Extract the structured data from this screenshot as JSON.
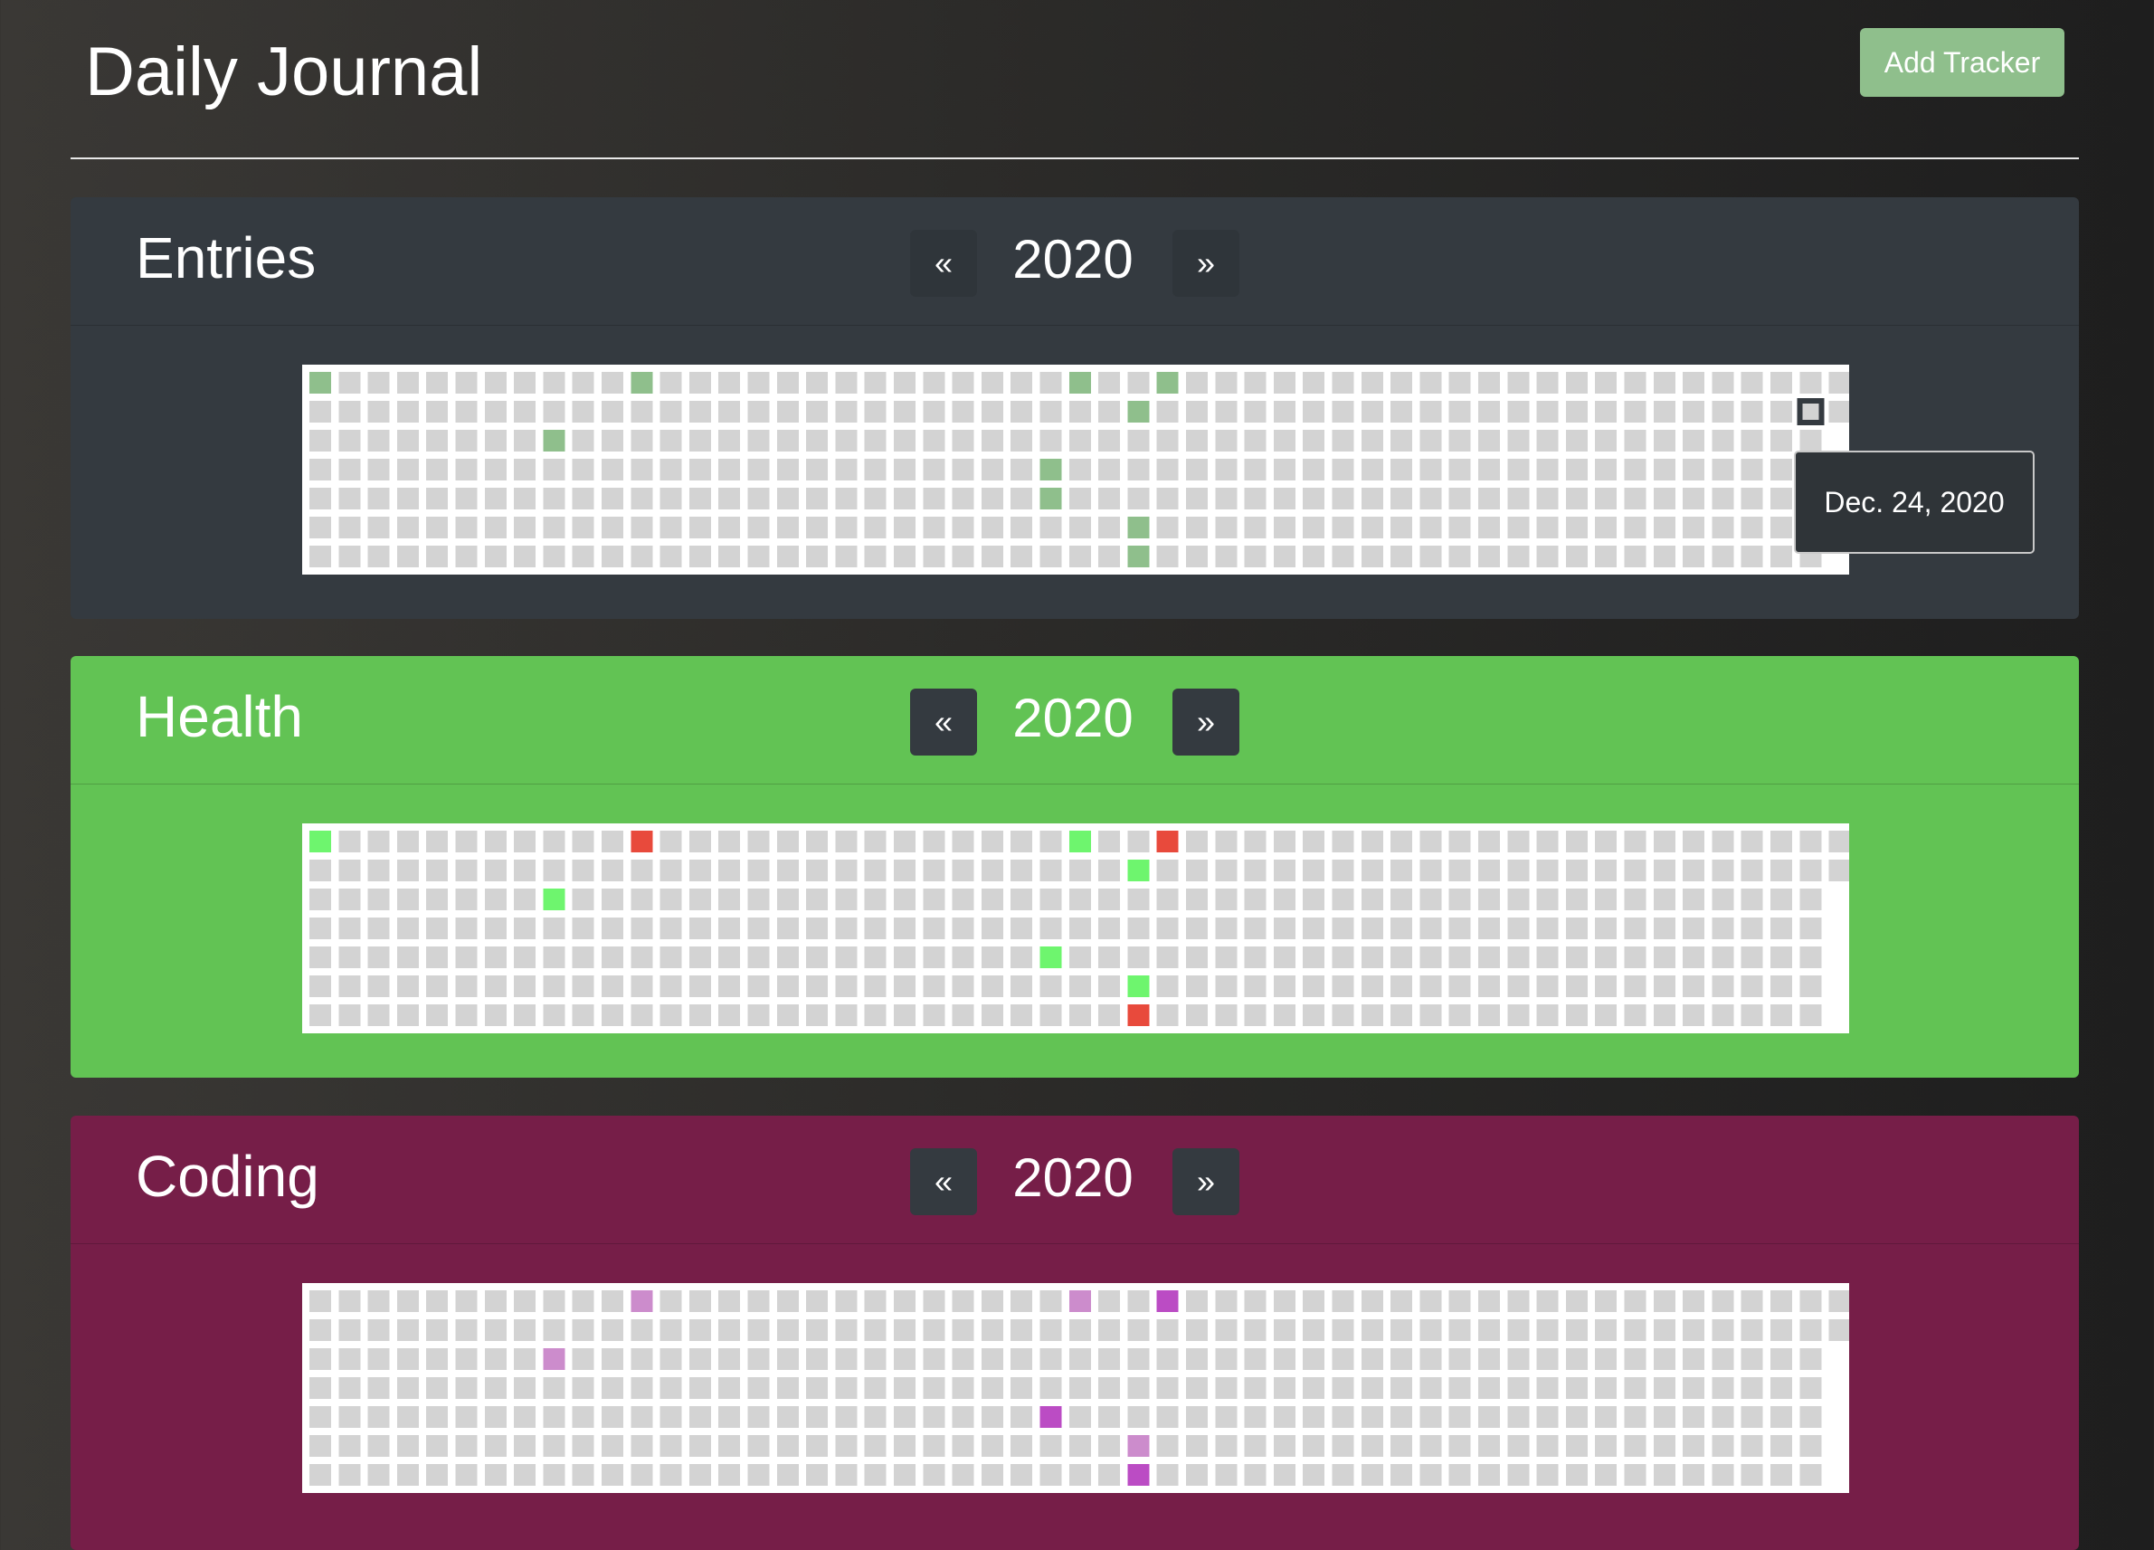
{
  "app": {
    "title": "Daily Journal",
    "add_tracker_label": "Add Tracker"
  },
  "trackers": [
    {
      "title": "Entries",
      "year": "2020",
      "prev_label": "«",
      "next_label": "»",
      "card_color": "#343a40",
      "nav_color": "#2f353a",
      "empty_color": "#d3d3d3",
      "marked_cells": [
        {
          "week": 0,
          "day": 0,
          "color": "#8fbf8c"
        },
        {
          "week": 8,
          "day": 2,
          "color": "#8fbf8c"
        },
        {
          "week": 11,
          "day": 0,
          "color": "#8fbf8c"
        },
        {
          "week": 25,
          "day": 3,
          "color": "#8fbf8c"
        },
        {
          "week": 25,
          "day": 4,
          "color": "#8fbf8c"
        },
        {
          "week": 26,
          "day": 0,
          "color": "#8fbf8c"
        },
        {
          "week": 28,
          "day": 1,
          "color": "#8fbf8c"
        },
        {
          "week": 28,
          "day": 5,
          "color": "#8fbf8c"
        },
        {
          "week": 28,
          "day": 6,
          "color": "#8fbf8c"
        },
        {
          "week": 29,
          "day": 0,
          "color": "#8fbf8c"
        }
      ],
      "selected_cell": {
        "week": 51,
        "day": 1
      },
      "tooltip": "Dec. 24, 2020"
    },
    {
      "title": "Health",
      "year": "2020",
      "prev_label": "«",
      "next_label": "»",
      "card_color": "#62c354",
      "nav_color": "#343a40",
      "empty_color": "#d3d3d3",
      "marked_cells": [
        {
          "week": 0,
          "day": 0,
          "color": "#6ef56e"
        },
        {
          "week": 8,
          "day": 2,
          "color": "#6ef56e"
        },
        {
          "week": 11,
          "day": 0,
          "color": "#e84a3c"
        },
        {
          "week": 25,
          "day": 4,
          "color": "#6ef56e"
        },
        {
          "week": 26,
          "day": 0,
          "color": "#6ef56e"
        },
        {
          "week": 28,
          "day": 1,
          "color": "#6ef56e"
        },
        {
          "week": 28,
          "day": 5,
          "color": "#6ef56e"
        },
        {
          "week": 28,
          "day": 6,
          "color": "#e84a3c"
        },
        {
          "week": 29,
          "day": 0,
          "color": "#e84a3c"
        }
      ]
    },
    {
      "title": "Coding",
      "year": "2020",
      "prev_label": "«",
      "next_label": "»",
      "card_color": "#761e48",
      "nav_color": "#343a40",
      "empty_color": "#d3d3d3",
      "marked_cells": [
        {
          "week": 8,
          "day": 2,
          "color": "#cc8ccc"
        },
        {
          "week": 11,
          "day": 0,
          "color": "#cc8ccc"
        },
        {
          "week": 25,
          "day": 4,
          "color": "#bb4cc4"
        },
        {
          "week": 26,
          "day": 0,
          "color": "#cc8ccc"
        },
        {
          "week": 28,
          "day": 5,
          "color": "#cc8ccc"
        },
        {
          "week": 28,
          "day": 6,
          "color": "#bb4cc4"
        },
        {
          "week": 29,
          "day": 0,
          "color": "#bb4cc4"
        }
      ]
    }
  ]
}
